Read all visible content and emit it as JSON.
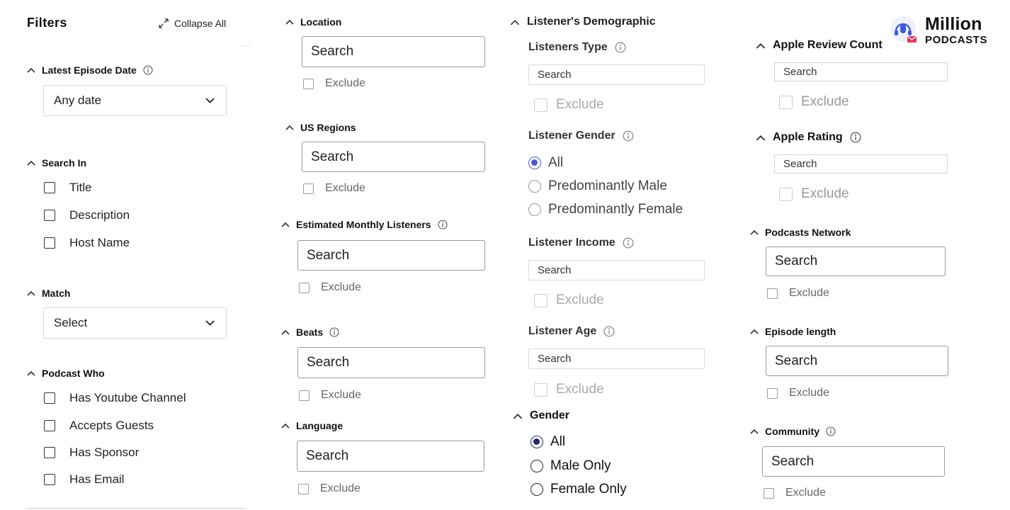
{
  "filters_panel": {
    "title": "Filters",
    "collapse_all": "Collapse All",
    "latest_episode_date": {
      "label": "Latest Episode Date",
      "value": "Any date"
    },
    "search_in": {
      "label": "Search In",
      "options": [
        "Title",
        "Description",
        "Host Name"
      ]
    },
    "match": {
      "label": "Match",
      "value": "Select"
    },
    "podcast_who": {
      "label": "Podcast Who",
      "options": [
        "Has Youtube Channel",
        "Accepts Guests",
        "Has Sponsor",
        "Has Email"
      ]
    }
  },
  "column2": {
    "location": {
      "label": "Location",
      "placeholder": "Search",
      "exclude": "Exclude"
    },
    "us_regions": {
      "label": "US Regions",
      "placeholder": "Search",
      "exclude": "Exclude"
    },
    "estimated_monthly_listeners": {
      "label": "Estimated Monthly Listeners",
      "placeholder": "Search",
      "exclude": "Exclude"
    },
    "beats": {
      "label": "Beats",
      "placeholder": "Search",
      "exclude": "Exclude"
    },
    "language": {
      "label": "Language",
      "placeholder": "Search",
      "exclude": "Exclude"
    }
  },
  "column3": {
    "listeners_demographic": "Listener's Demographic",
    "listeners_type": {
      "label": "Listeners Type",
      "placeholder": "Search",
      "exclude": "Exclude"
    },
    "listener_gender": {
      "label": "Listener Gender",
      "options": [
        "All",
        "Predominantly Male",
        "Predominantly Female"
      ],
      "selected": "All"
    },
    "listener_income": {
      "label": "Listener Income",
      "placeholder": "Search",
      "exclude": "Exclude"
    },
    "listener_age": {
      "label": "Listener Age",
      "placeholder": "Search",
      "exclude": "Exclude"
    },
    "gender": {
      "label": "Gender",
      "options": [
        "All",
        "Male Only",
        "Female Only"
      ],
      "selected": "All"
    }
  },
  "column4": {
    "brand": {
      "name": "Million",
      "sub": "PODCASTS",
      "accent": "#e8325a",
      "secondary": "#3b5bdb"
    },
    "apple_review_count": {
      "label": "Apple Review Count",
      "placeholder": "Search",
      "exclude": "Exclude"
    },
    "apple_rating": {
      "label": "Apple Rating",
      "placeholder": "Search",
      "exclude": "Exclude"
    },
    "podcasts_network": {
      "label": "Podcasts Network",
      "placeholder": "Search",
      "exclude": "Exclude"
    },
    "episode_length": {
      "label": "Episode length",
      "placeholder": "Search",
      "exclude": "Exclude"
    },
    "community": {
      "label": "Community",
      "placeholder": "Search",
      "exclude": "Exclude"
    }
  },
  "colors": {
    "radio_accent": "#4a5bd6",
    "radio_dark": "#1e2a78"
  }
}
